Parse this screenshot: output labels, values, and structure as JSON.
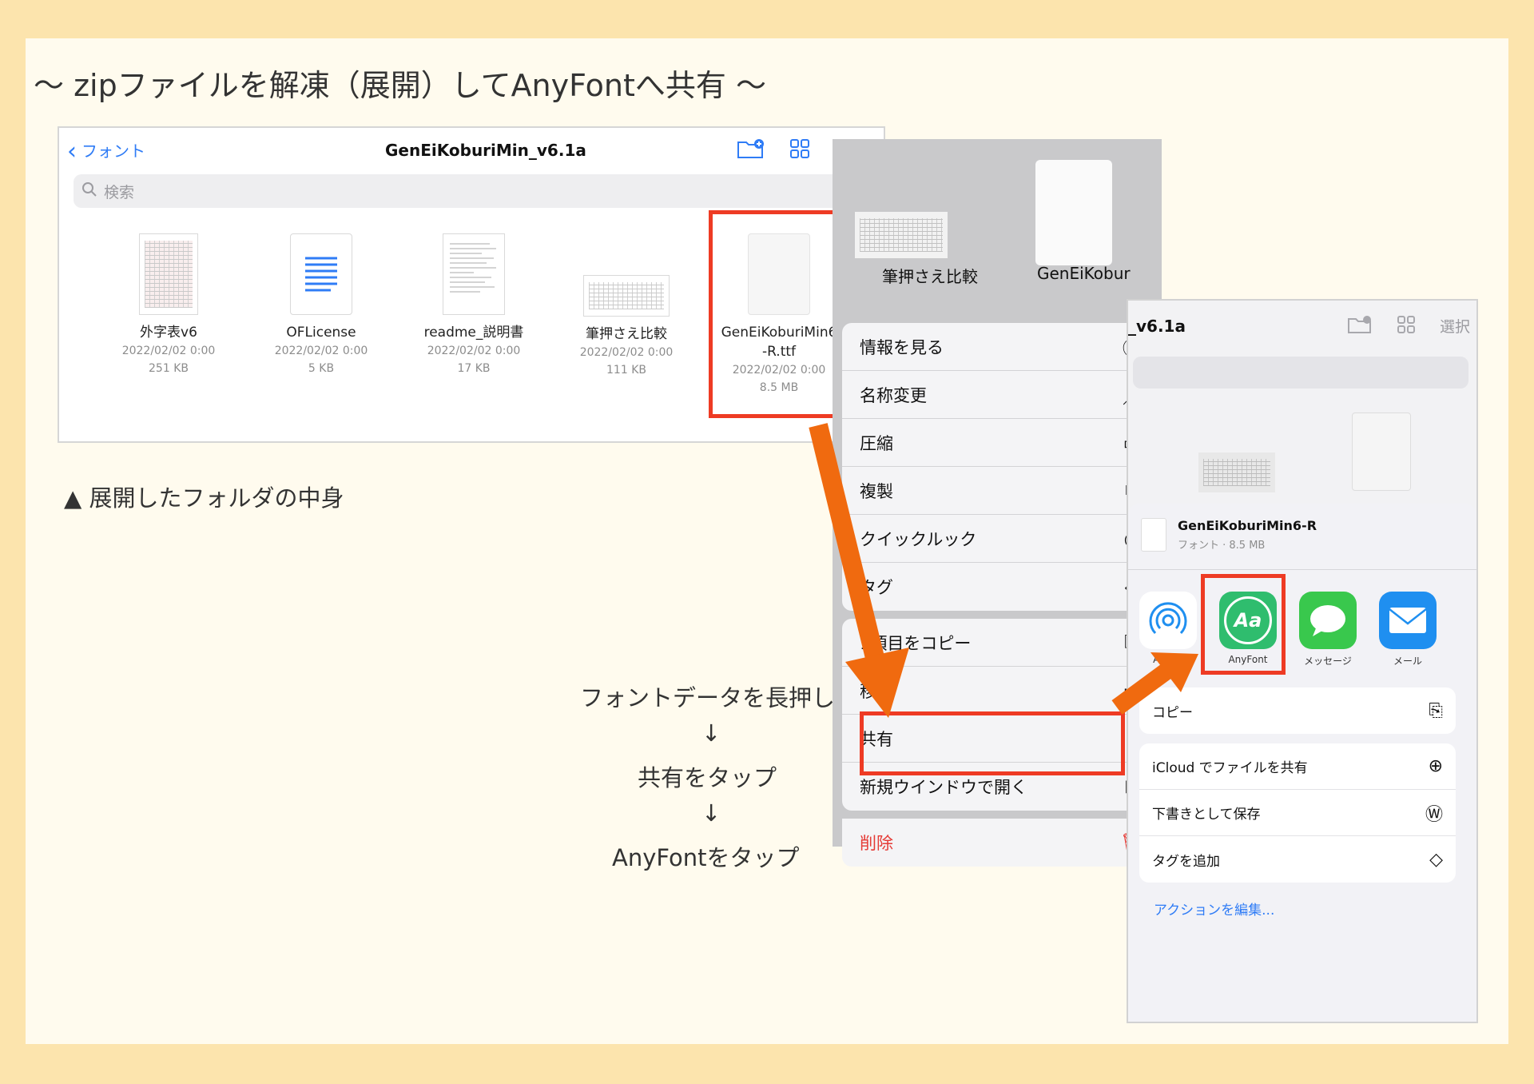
{
  "heading": "〜 zipファイルを解凍（展開）してAnyFontへ共有 〜",
  "files": {
    "back_label": "フォント",
    "title": "GenEiKoburiMin_v6.1a",
    "select_label": "選択",
    "search_placeholder": "検索",
    "items": [
      {
        "name": "外字表v6",
        "date": "2022/02/02 0:00",
        "size": "251 KB"
      },
      {
        "name": "OFLicense",
        "date": "2022/02/02 0:00",
        "size": "5 KB"
      },
      {
        "name": "readme_説明書",
        "date": "2022/02/02 0:00",
        "size": "17 KB"
      },
      {
        "name": "筆押さえ比較",
        "date": "2022/02/02 0:00",
        "size": "111 KB"
      },
      {
        "name": "GenEiKoburiMin6-R.ttf",
        "name_line1": "GenEiKoburiMin6",
        "name_line2": "-R.ttf",
        "date": "2022/02/02 0:00",
        "size": "8.5 MB"
      }
    ]
  },
  "captions": {
    "folder_contents": "▲ 展開したフォルダの中身",
    "step1": "フォントデータを長押し",
    "arrow1": "↓",
    "step2": "共有をタップ",
    "arrow2": "↓",
    "step3": "AnyFontをタップ"
  },
  "preview": {
    "left_label": "筆押さえ比較",
    "right_label": "GenEiKobur"
  },
  "context_menu": {
    "items": [
      {
        "label": "情報を見る",
        "icon": "ⓘ"
      },
      {
        "label": "名称変更",
        "icon": "／"
      },
      {
        "label": "圧縮",
        "icon": "▭"
      },
      {
        "label": "複製",
        "icon": "⧉"
      },
      {
        "label": "クイックルック",
        "icon": "◉"
      },
      {
        "label": "タグ",
        "icon": "◇"
      },
      {
        "label": "1項目をコピー",
        "icon": "⎘"
      },
      {
        "label": "移動",
        "icon": "▭"
      },
      {
        "label": "共有",
        "icon": "⇧"
      },
      {
        "label": "新規ウインドウで開く",
        "icon": "⊞"
      },
      {
        "label": "削除",
        "icon": "🗑"
      }
    ]
  },
  "share": {
    "top_title": "_v6.1a",
    "top_select": "選択",
    "file_name": "GenEiKoburiMin6-R",
    "file_meta": "フォント · 8.5 MB",
    "apps": [
      {
        "label": "AirDro",
        "icon": "airdrop-icon",
        "color": "#ffffff"
      },
      {
        "label": "AnyFont",
        "icon": "anyfont-icon",
        "glyph": "Aa",
        "color": "#2fbd6e"
      },
      {
        "label": "メッセージ",
        "icon": "messages-icon",
        "color": "#39c84d"
      },
      {
        "label": "メール",
        "icon": "mail-icon",
        "color": "#1f8ff0"
      }
    ],
    "actions_group1": [
      {
        "label": "コピー",
        "icon": "⎘"
      }
    ],
    "actions_group2": [
      {
        "label": "iCloud でファイルを共有",
        "icon": "⊕"
      },
      {
        "label": "下書きとして保存",
        "icon": "Ⓦ"
      },
      {
        "label": "タグを追加",
        "icon": "◇"
      }
    ],
    "edit_actions": "アクションを編集..."
  },
  "colors": {
    "accent": "#2f7cf6",
    "highlight": "#ee3b24",
    "arrow": "#f06a0f",
    "background": "#fce4ad"
  }
}
